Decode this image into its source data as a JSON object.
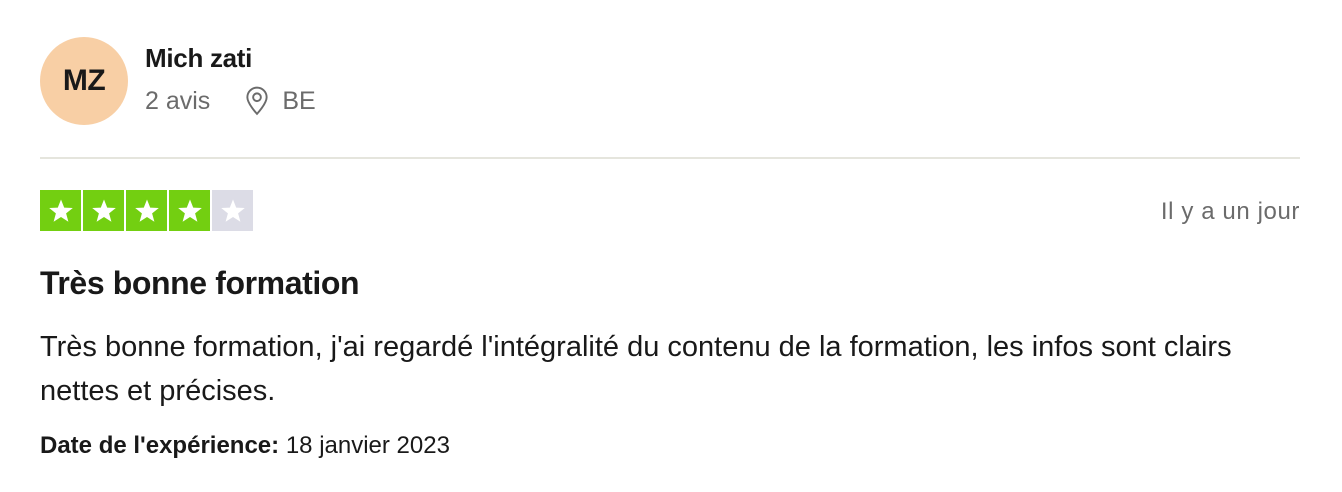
{
  "reviewer": {
    "initials": "MZ",
    "name": "Mich zati",
    "reviews_count": "2 avis",
    "country": "BE",
    "avatar_color": "#f8cfa5"
  },
  "review": {
    "rating": 4,
    "max_rating": 5,
    "star_color": "#73cf11",
    "empty_star_color": "#dcdce6",
    "posted": "Il y a un jour",
    "title": "Très bonne formation",
    "body": "Très bonne formation, j'ai regardé l'intégralité du contenu de la formation, les infos sont clairs nettes et précises.",
    "experience_label": "Date de l'expérience:",
    "experience_date": "18 janvier 2023"
  },
  "icons": {
    "location": "location-pin-icon",
    "star": "star-icon"
  }
}
